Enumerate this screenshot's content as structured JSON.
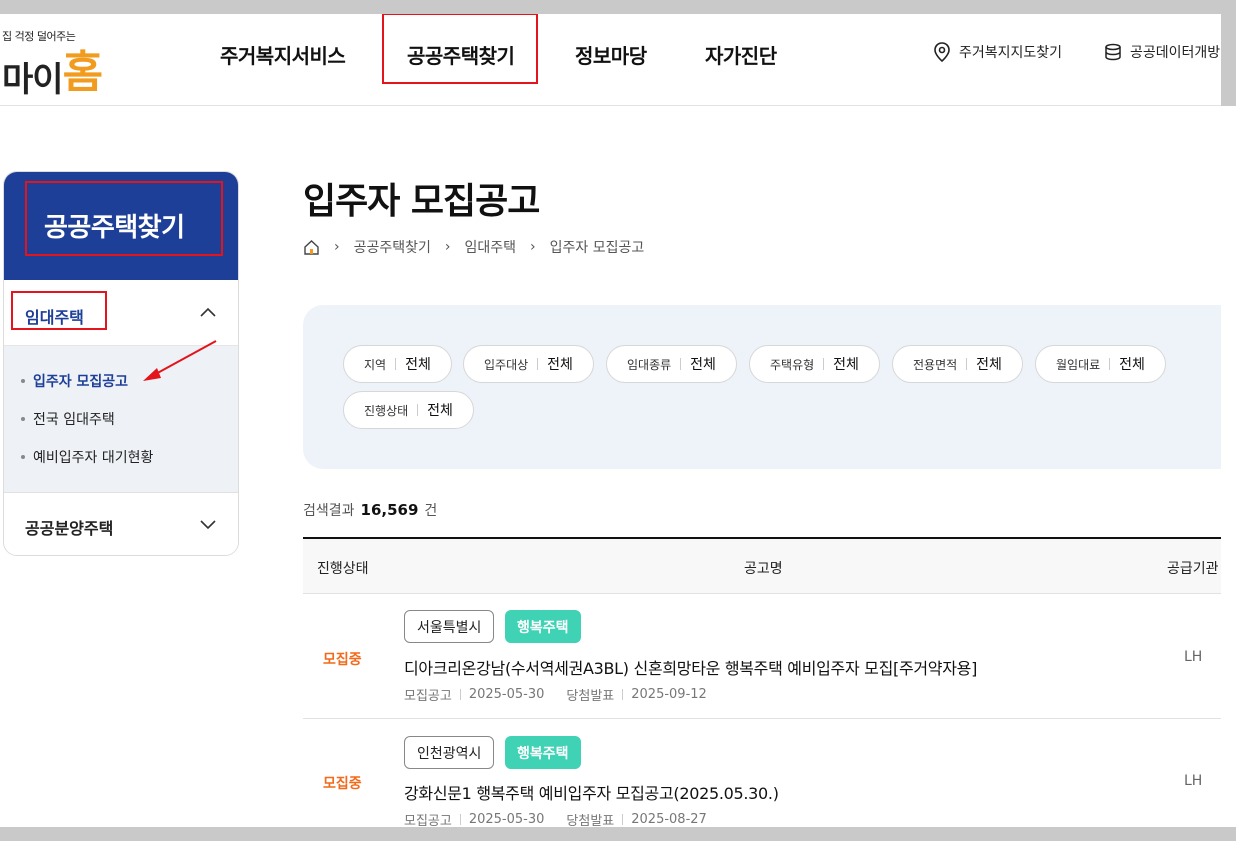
{
  "logo": {
    "tagline": "집 걱정 덜어주는",
    "brand_text": "마이",
    "brand_accent": "홈"
  },
  "gnb": [
    "주거복지서비스",
    "공공주택찾기",
    "정보마당",
    "자가진단"
  ],
  "util": {
    "map_label": "주거복지지도찾기",
    "data_label": "공공데이터개방"
  },
  "sidebar": {
    "title": "공공주택찾기",
    "section1": "임대주택",
    "items": [
      "입주자 모집공고",
      "전국 임대주택",
      "예비입주자 대기현황"
    ],
    "section2": "공공분양주택"
  },
  "page": {
    "title": "입주자 모집공고",
    "breadcrumb": [
      "공공주택찾기",
      "임대주택",
      "입주자 모집공고"
    ]
  },
  "filters": [
    {
      "label": "지역",
      "value": "전체"
    },
    {
      "label": "입주대상",
      "value": "전체"
    },
    {
      "label": "임대종류",
      "value": "전체"
    },
    {
      "label": "주택유형",
      "value": "전체"
    },
    {
      "label": "전용면적",
      "value": "전체"
    },
    {
      "label": "월임대료",
      "value": "전체"
    },
    {
      "label": "진행상태",
      "value": "전체"
    }
  ],
  "result": {
    "label": "검색결과",
    "count": "16,569",
    "unit": "건"
  },
  "table": {
    "headers": [
      "진행상태",
      "공고명",
      "공급기관"
    ],
    "rows": [
      {
        "status": "모집중",
        "region": "서울특별시",
        "type": "행복주택",
        "title": "디아크리온강남(수서역세권A3BL) 신혼희망타운 행복주택 예비입주자 모집[주거약자용]",
        "post_label": "모집공고",
        "post_date": "2025-05-30",
        "announce_label": "당첨발표",
        "announce_date": "2025-09-12",
        "org": "LH"
      },
      {
        "status": "모집중",
        "region": "인천광역시",
        "type": "행복주택",
        "title": "강화신문1 행복주택 예비입주자 모집공고(2025.05.30.)",
        "post_label": "모집공고",
        "post_date": "2025-05-30",
        "announce_label": "당첨발표",
        "announce_date": "2025-08-27",
        "org": "LH"
      }
    ]
  },
  "colors": {
    "primary": "#1e3f98",
    "status": "#f26a1b",
    "badge": "#3fd2b5",
    "highlight": "#e3141b",
    "logo_accent": "#f29c1f"
  }
}
